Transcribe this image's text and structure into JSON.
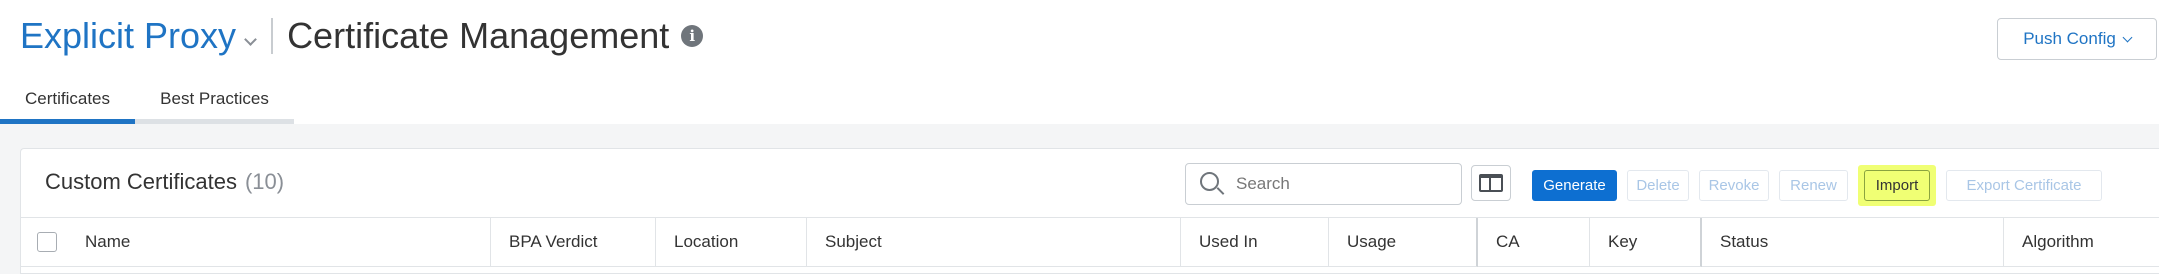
{
  "header": {
    "app_name": "Explicit Proxy",
    "page_title": "Certificate Management",
    "push_config_label": "Push Config"
  },
  "tabs": [
    {
      "label": "Certificates",
      "active": true
    },
    {
      "label": "Best Practices",
      "active": false
    }
  ],
  "card": {
    "title": "Custom Certificates",
    "count": "(10)"
  },
  "search": {
    "placeholder": "Search",
    "value": ""
  },
  "toolbar": {
    "generate": "Generate",
    "delete": "Delete",
    "revoke": "Revoke",
    "renew": "Renew",
    "import": "Import",
    "export": "Export Certificate"
  },
  "table": {
    "columns": [
      "Name",
      "BPA Verdict",
      "Location",
      "Subject",
      "Used In",
      "Usage",
      "CA",
      "Key",
      "Status",
      "Algorithm"
    ]
  },
  "colors": {
    "accent": "#1f74c4",
    "primary_button": "#0d6fd1",
    "highlight": "#f0ff74"
  },
  "icons": [
    "chevron-down-icon",
    "info-icon",
    "search-icon",
    "columns-icon"
  ]
}
